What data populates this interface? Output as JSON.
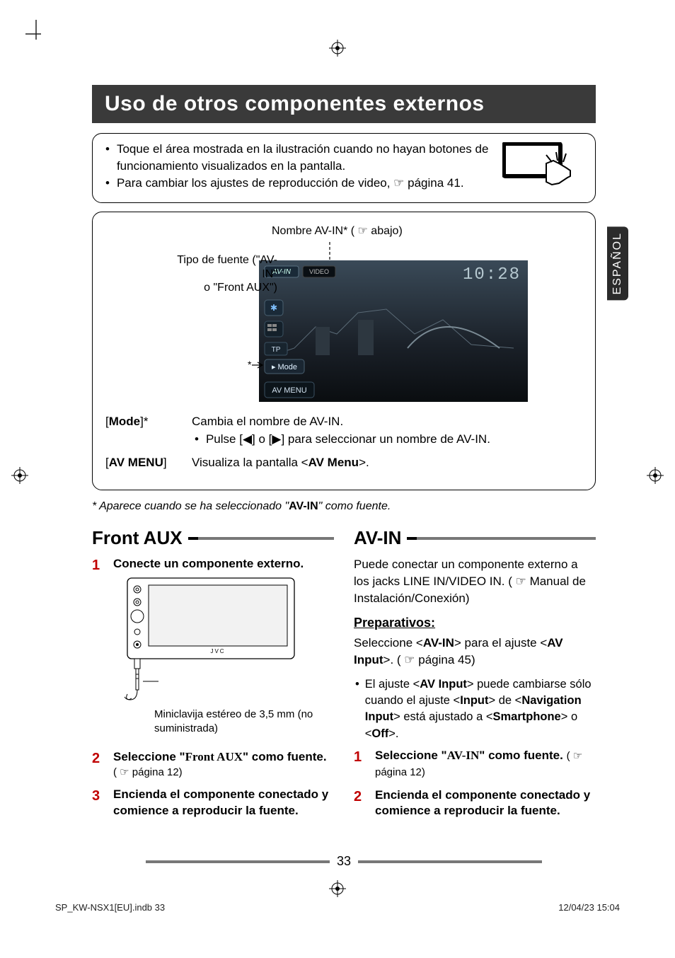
{
  "heading": "Uso de otros componentes externos",
  "language_tab": "ESPAÑOL",
  "notice": {
    "item1": "Toque el área mostrada en la ilustración cuando no hayan botones de funcionamiento visualizados en la pantalla.",
    "item2_pre": "Para cambiar los ajustes de reproducción de video, ",
    "item2_post": " página 41."
  },
  "screen": {
    "avin_name_label": "Nombre AV-IN* ( ☞ abajo)",
    "source_type_line1": "Tipo de fuente (\"AV-IN\"",
    "source_type_line2": "o \"Front AUX\")",
    "screen_avin_text": "AV-IN",
    "screen_video_text": "VIDEO",
    "screen_clock": "10:28",
    "screen_tp": "TP",
    "screen_mode": "Mode",
    "screen_avmenu": "AV MENU",
    "asterisk_pointer": "*",
    "row1_label": "[Mode]*",
    "row1_text": "Cambia el nombre de AV-IN.",
    "row1_sub_pre": "Pulse [",
    "row1_sub_mid": "] o [",
    "row1_sub_post": "] para seleccionar un nombre de AV-IN.",
    "row2_label_open": "[",
    "row2_label_bold": "AV MENU",
    "row2_label_close": "]",
    "row2_text_pre": "Visualiza la pantalla <",
    "row2_text_bold": "AV Menu",
    "row2_text_post": ">."
  },
  "footnote_pre": "* Aparece cuando se ha seleccionado \"",
  "footnote_bold": "AV-IN",
  "footnote_post": "\" como fuente.",
  "col_left": {
    "title": "Front AUX",
    "step1_title": "Conecte un componente externo.",
    "device_brand": "JVC",
    "caption": "Miniclavija estéreo de 3,5 mm (no suministrada)",
    "step2_title_pre": "Seleccione \"",
    "step2_title_bold": "Front AUX",
    "step2_title_post": "\" como fuente.",
    "step2_sub": "( ☞ página 12)",
    "step3_title": "Encienda el componente conectado y comience a reproducir la fuente."
  },
  "col_right": {
    "title": "AV-IN",
    "intro_pre": "Puede conectar un componente externo a los jacks LINE IN/VIDEO IN. ( ☞ Manual de Instalación/Conexión)",
    "prep_heading": "Preparativos:",
    "prep_text_pre": "Seleccione <",
    "prep_text_b1": "AV-IN",
    "prep_text_mid": "> para el ajuste <",
    "prep_text_b2": "AV Input",
    "prep_text_post": ">. ( ☞ página 45)",
    "prep_bullet_pre": "El ajuste <",
    "prep_bullet_b1": "AV Input",
    "prep_bullet_m1": "> puede cambiarse sólo cuando el ajuste <",
    "prep_bullet_b2": "Input",
    "prep_bullet_m2": "> de <",
    "prep_bullet_b3": "Navigation Input",
    "prep_bullet_m3": "> está ajustado a <",
    "prep_bullet_b4": "Smartphone",
    "prep_bullet_m4": "> o <",
    "prep_bullet_b5": "Off",
    "prep_bullet_end": ">.",
    "step1_pre": "Seleccione \"",
    "step1_bold": "AV-IN",
    "step1_post": "\" como fuente.",
    "step1_sub": "( ☞ página 12)",
    "step2_title": "Encienda el componente conectado y comience a reproducir la fuente."
  },
  "page_number": "33",
  "footer_left": "SP_KW-NSX1[EU].indb   33",
  "footer_right": "12/04/23   15:04"
}
